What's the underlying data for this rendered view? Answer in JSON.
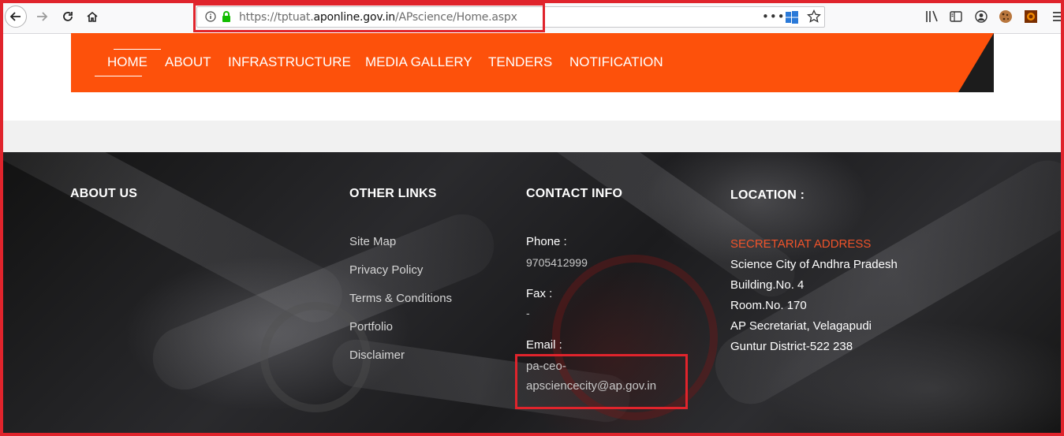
{
  "browser": {
    "url_prefix": "https://tptuat.",
    "url_domain": "aponline.gov.in",
    "url_path": "/APscience/Home.aspx",
    "icons": [
      "back-icon",
      "forward-icon",
      "reload-icon",
      "home-icon",
      "info-icon",
      "lock-icon",
      "more-icon",
      "windows-icon",
      "bookmark-star-icon",
      "library-icon",
      "sidebar-icon",
      "account-icon",
      "cookie-icon",
      "extension-icon",
      "menu-icon"
    ]
  },
  "nav": {
    "items": [
      "HOME",
      "ABOUT",
      "INFRASTRUCTURE",
      "MEDIA GALLERY",
      "TENDERS",
      "NOTIFICATION"
    ],
    "color": "#fd510b"
  },
  "footer": {
    "about_heading": "ABOUT US",
    "links_heading": "OTHER LINKS",
    "links": [
      "Site Map",
      "Privacy Policy",
      "Terms & Conditions",
      "Portfolio",
      "Disclaimer"
    ],
    "contact_heading": "CONTACT INFO",
    "phone_label": "Phone :",
    "phone_value": "9705412999",
    "fax_label": "Fax :",
    "fax_value": "-",
    "email_label": "Email :",
    "email_line1": "pa-ceo-",
    "email_line2": "apsciencecity@ap.gov.in",
    "location_heading": "LOCATION :",
    "address_title": "SECRETARIAT ADDRESS",
    "address_lines": [
      "Science City of Andhra Pradesh",
      "Building.No. 4",
      "Room.No. 170",
      "AP Secretariat, Velagapudi",
      "Guntur District-522 238"
    ]
  }
}
